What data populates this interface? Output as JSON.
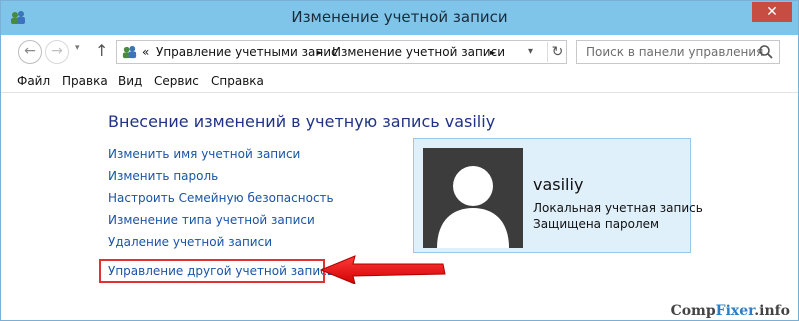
{
  "window": {
    "title": "Изменение учетной записи",
    "close_glyph": "✕"
  },
  "nav": {
    "back_glyph": "←",
    "forward_glyph": "→",
    "dropdown_glyph": "▾",
    "up_glyph": "↑",
    "refresh_glyph": "↻",
    "address": {
      "prefix": "«",
      "crumb1": "Управление учетными запис",
      "separator1": "►",
      "crumb2": "Изменение учетной записи",
      "separator2": "►"
    },
    "search_placeholder": "Поиск в панели управления"
  },
  "menu": {
    "file": "Файл",
    "edit": "Правка",
    "view": "Вид",
    "service": "Сервис",
    "help": "Справка"
  },
  "content": {
    "heading": "Внесение изменений в учетную запись vasiliy",
    "links": {
      "rename": "Изменить имя учетной записи",
      "password": "Изменить пароль",
      "family": "Настроить Семейную безопасность",
      "type": "Изменение типа учетной записи",
      "delete": "Удаление учетной записи",
      "manage_other": "Управление другой учетной записью"
    }
  },
  "account": {
    "name": "vasiliy",
    "type": "Локальная учетная запись",
    "status": "Защищена паролем"
  },
  "watermark": {
    "part1": "Comp",
    "part2": "Fixer",
    "part3": ".info"
  },
  "colors": {
    "titlebar": "#7fc5ea",
    "link": "#1a54a6",
    "heading": "#1e3287",
    "highlight": "#e23131",
    "tile_bg": "#dff0fb"
  },
  "icons": {
    "title": "users-control-panel-icon",
    "address": "users-control-panel-icon",
    "search": "search-icon",
    "avatar": "user-avatar-icon",
    "arrow": "red-arrow-icon"
  }
}
